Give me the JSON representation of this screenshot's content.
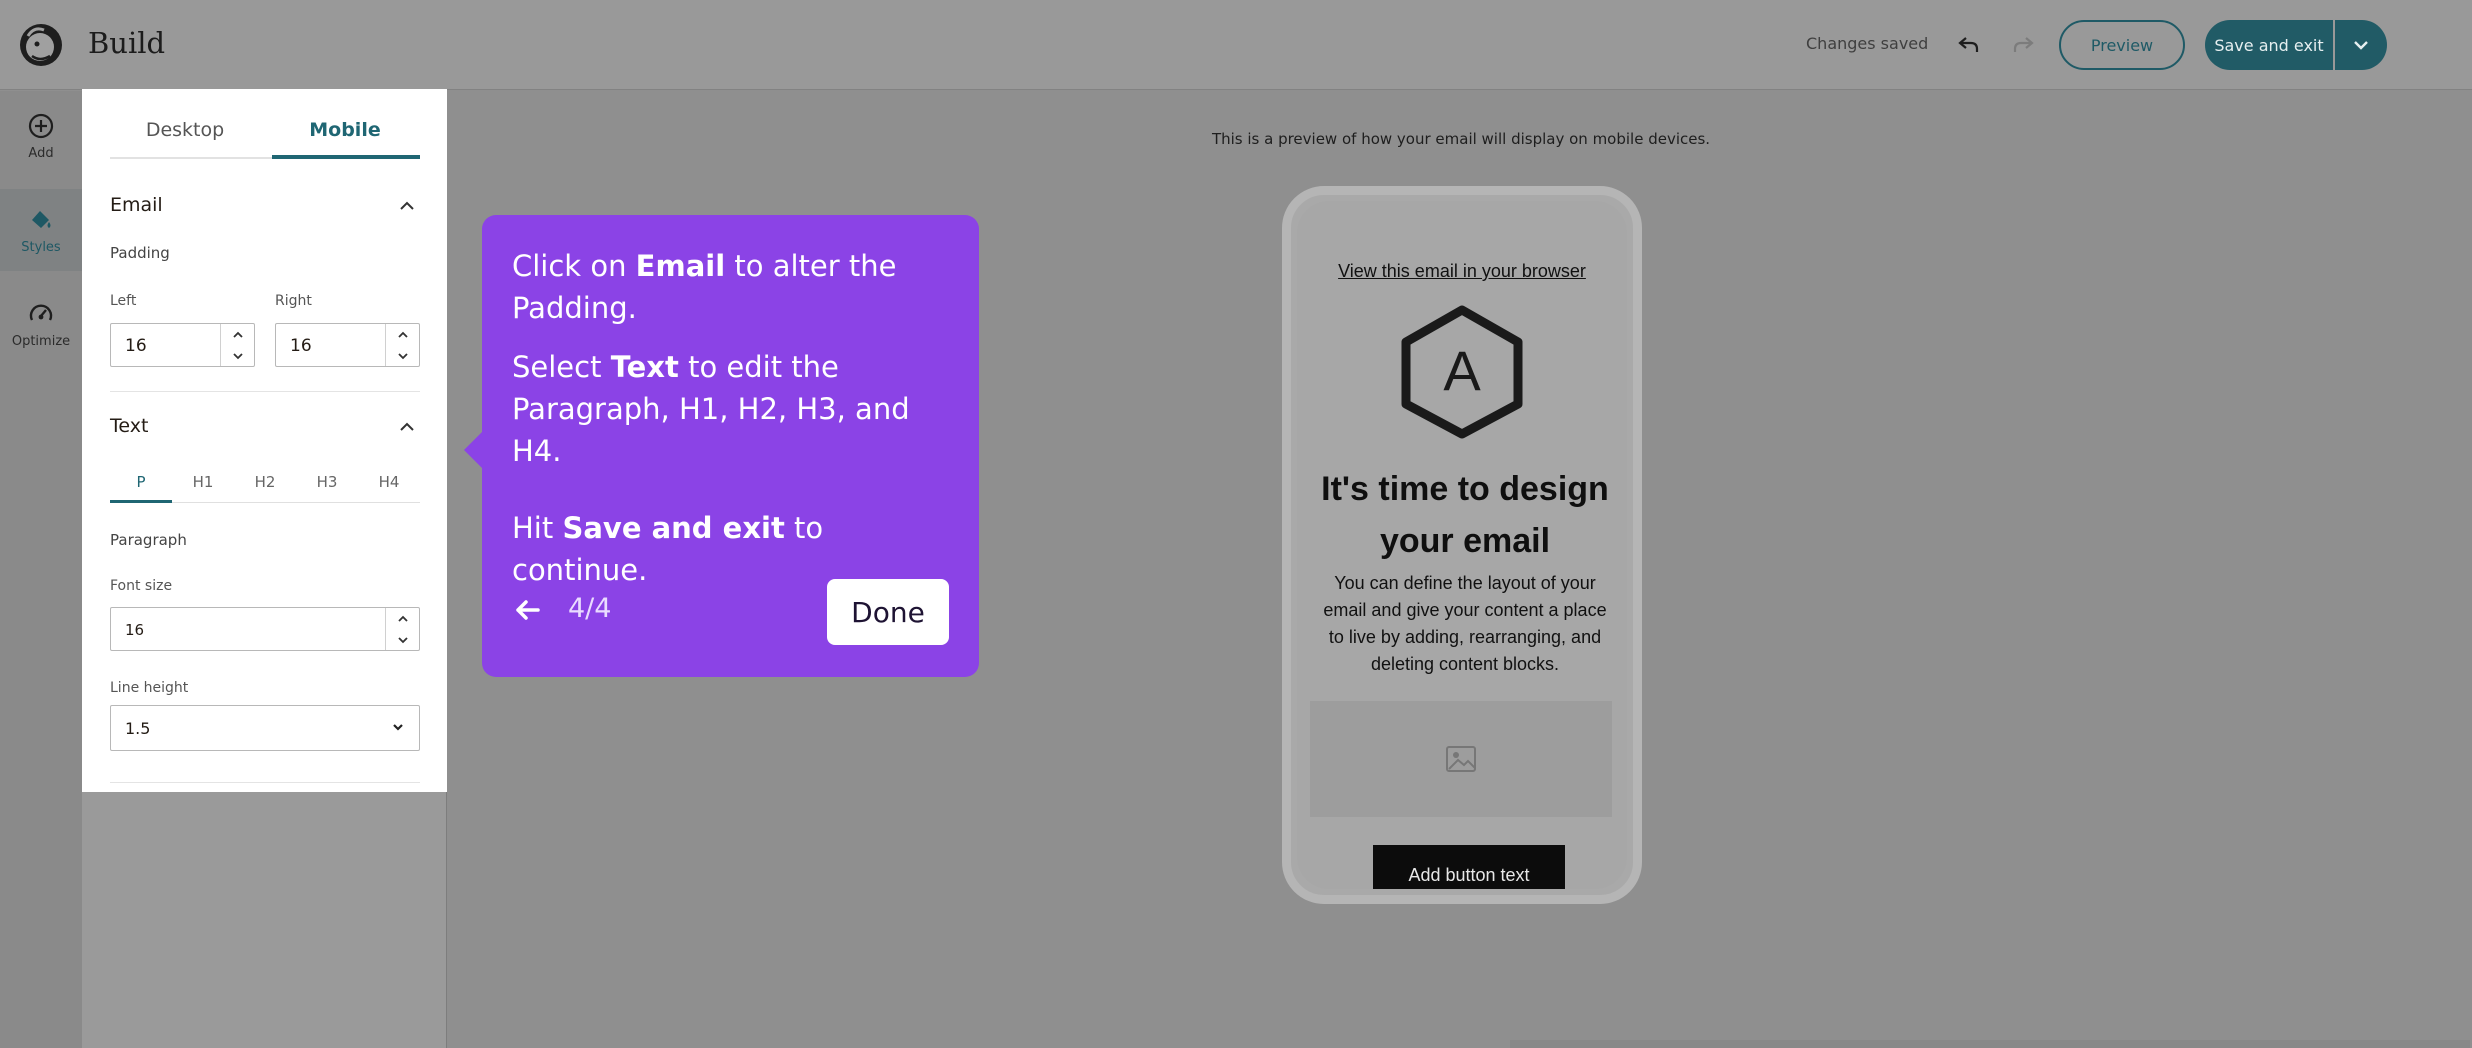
{
  "header": {
    "title": "Build",
    "status": "Changes saved",
    "preview_label": "Preview",
    "save_exit_label": "Save and exit"
  },
  "rail": {
    "items": [
      {
        "label": "Add",
        "icon": "plus-circle-icon"
      },
      {
        "label": "Styles",
        "icon": "paint-bucket-icon"
      },
      {
        "label": "Optimize",
        "icon": "gauge-icon"
      }
    ]
  },
  "panel": {
    "tabs": [
      "Desktop",
      "Mobile"
    ],
    "active_tab": "Mobile",
    "email_section": {
      "title": "Email",
      "padding_label": "Padding",
      "left_label": "Left",
      "left_value": "16",
      "right_label": "Right",
      "right_value": "16"
    },
    "text_section": {
      "title": "Text",
      "tabs": [
        "P",
        "H1",
        "H2",
        "H3",
        "H4"
      ],
      "active_tab": "P",
      "subhead": "Paragraph",
      "font_size_label": "Font size",
      "font_size_value": "16",
      "line_height_label": "Line height",
      "line_height_value": "1.5"
    }
  },
  "preview": {
    "note": "This is a preview of how your email will display on mobile devices.",
    "browser_link": "View this email in your browser",
    "logo_letter": "A",
    "heading": "It's time to design your email",
    "body": "You can define the layout of your email and give your content a place to live by adding, rearranging, and deleting content blocks.",
    "button_text": "Add button text"
  },
  "tooltip": {
    "p1_a": "Click on ",
    "p1_b": "Email",
    "p1_c": " to alter the Padding.",
    "p2_a": "Select ",
    "p2_b": "Text",
    "p2_c": " to edit the Paragraph, H1, H2, H3, and H4.",
    "p3_a": "Hit ",
    "p3_b": "Save and exit",
    "p3_c": " to continue.",
    "step": "4/4",
    "done_label": "Done",
    "color": "#8b43e6"
  },
  "colors": {
    "accent": "#1f6673",
    "primary_button": "#215b66"
  }
}
